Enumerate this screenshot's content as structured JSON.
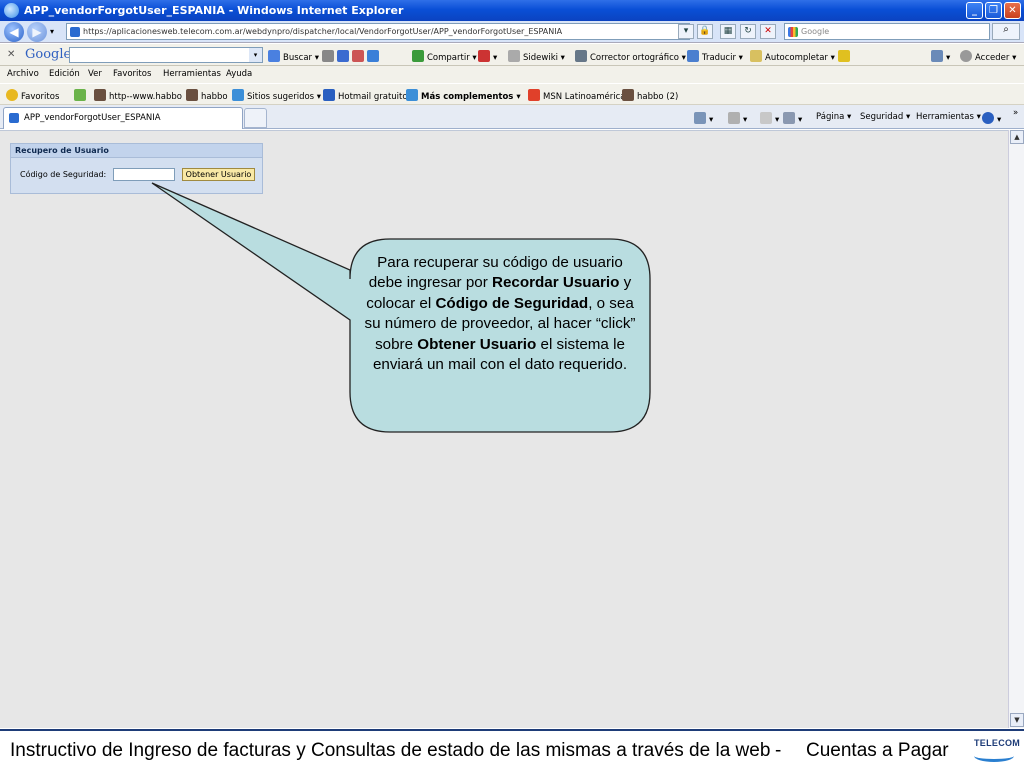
{
  "window": {
    "title": "APP_vendorForgotUser_ESPANIA - Windows Internet Explorer",
    "minimize": "_",
    "maximize": "❐",
    "close": "✕"
  },
  "address": {
    "url": "https://aplicacionesweb.telecom.com.ar/webdynpro/dispatcher/local/VendorForgotUser/APP_vendorForgotUser_ESPANIA",
    "search_placeholder": "Google"
  },
  "google_toolbar": {
    "logo": "Google",
    "items": [
      "Buscar",
      "Compartir",
      "Sidewiki",
      "Corrector ortográfico",
      "Traducir",
      "Autocompletar",
      "Acceder"
    ]
  },
  "menu": {
    "items": [
      "Archivo",
      "Edición",
      "Ver",
      "Favoritos",
      "Herramientas",
      "Ayuda"
    ]
  },
  "favorites": {
    "label": "Favoritos",
    "items": [
      "http--www.habbo",
      "habbo",
      "Sitios sugeridos",
      "Hotmail gratuito",
      "Más complementos",
      "MSN Latinoamérica",
      "habbo (2)"
    ]
  },
  "tabs": {
    "active": "APP_vendorForgotUser_ESPANIA",
    "commands": [
      "Página",
      "Seguridad",
      "Herramientas"
    ]
  },
  "form": {
    "header": "Recupero de Usuario",
    "label": "Código de Seguridad:",
    "input_value": "",
    "button": "Obtener Usuario"
  },
  "callout": {
    "t1": "Para recuperar su código de usuario debe ingresar por ",
    "b1": "Recordar Usuario",
    "t2": " y colocar el ",
    "b2": "Código de Seguridad",
    "t3": ", o sea su número de proveedor, al hacer “click” sobre ",
    "b3": "Obtener Usuario",
    "t4": " el sistema le enviará un mail  con el dato requerido."
  },
  "footer": {
    "text": "Instructivo de Ingreso de facturas y Consultas de estado de las mismas a través de la web",
    "separator": "-",
    "right": "Cuentas a Pagar",
    "logo": "TELECOM"
  },
  "colors": {
    "callout_fill": "#b9dde0",
    "titlebar": "#0a4fd6",
    "footer_rule": "#1e3c78"
  }
}
